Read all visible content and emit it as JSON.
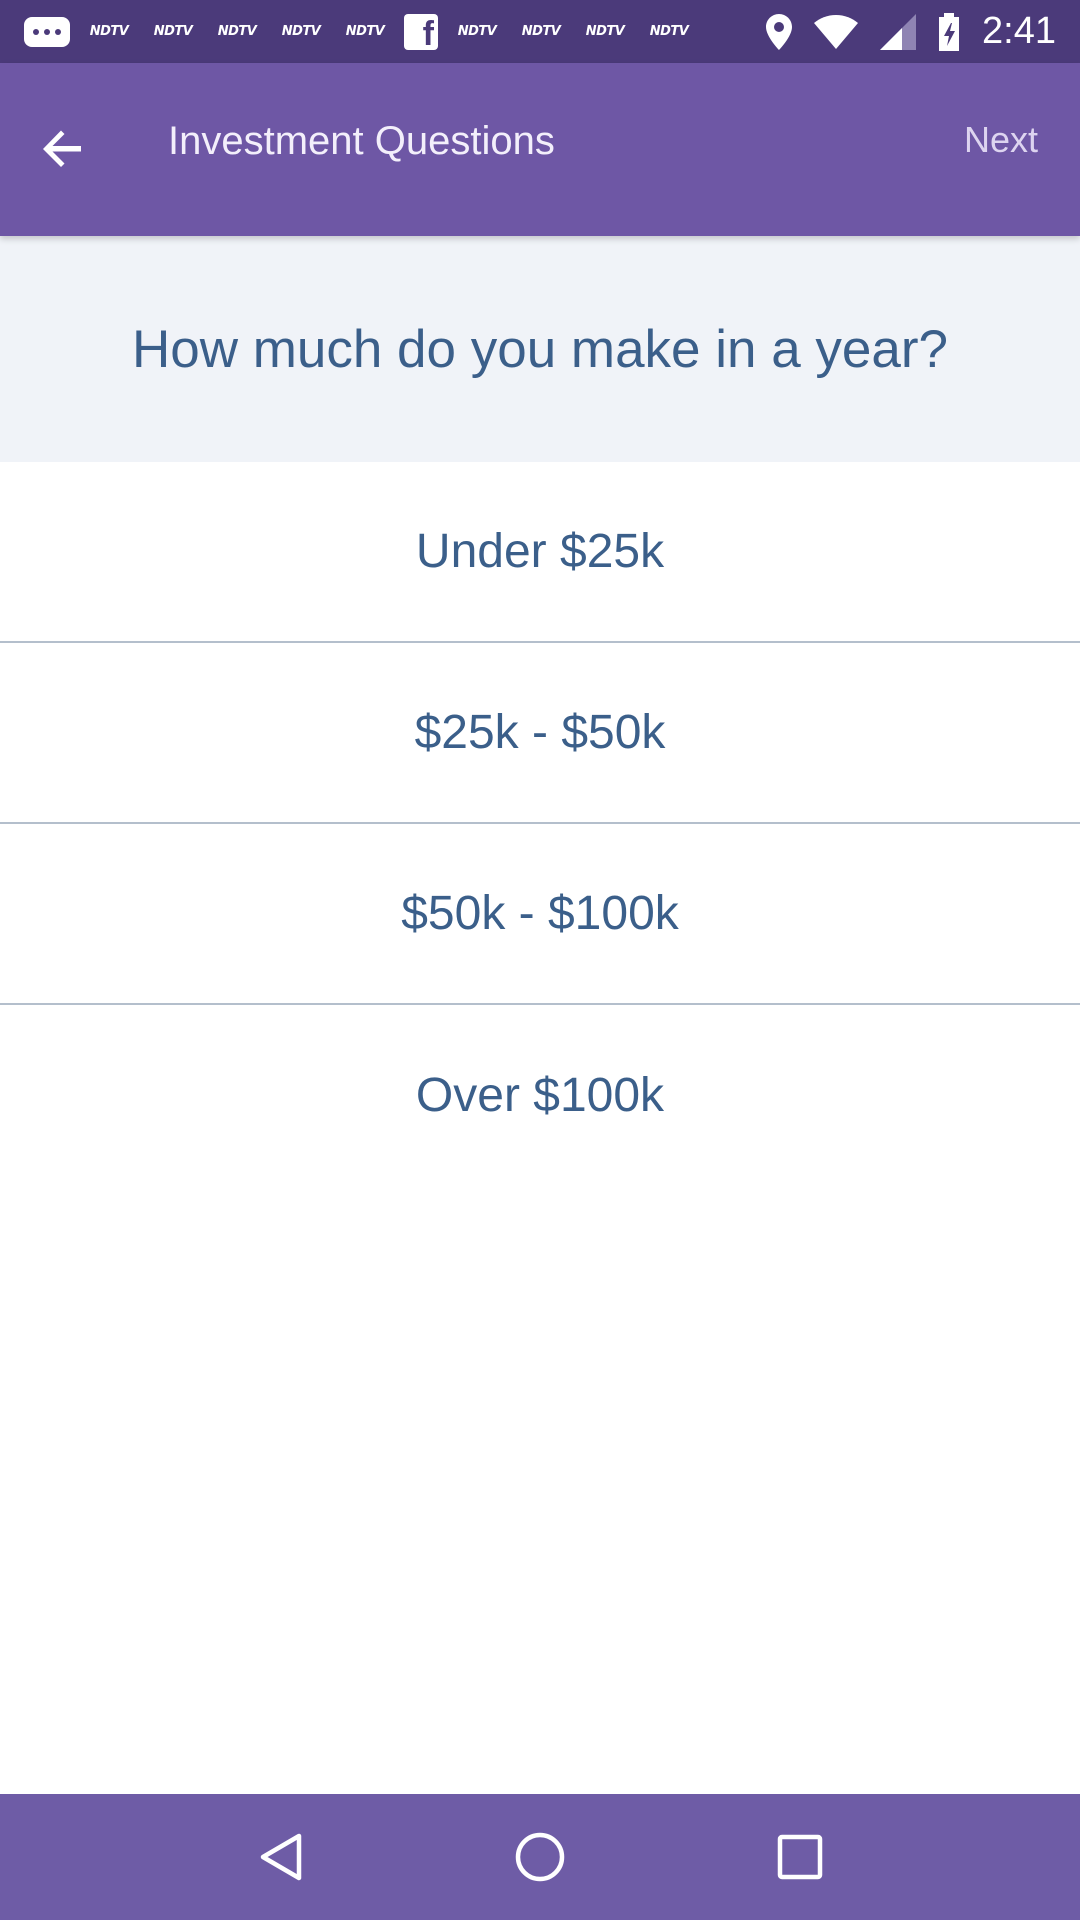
{
  "status_bar": {
    "notification_icons": [
      "message-icon",
      "ndtv",
      "ndtv",
      "ndtv",
      "ndtv",
      "ndtv",
      "facebook-icon",
      "ndtv",
      "ndtv",
      "ndtv",
      "ndtv"
    ],
    "ndtv_label": "NDTV",
    "time": "2:41"
  },
  "app_bar": {
    "title": "Investment Questions",
    "next_label": "Next",
    "background": "#6e57a5"
  },
  "question": {
    "text": "How much do you make in a year?"
  },
  "options": [
    {
      "label": "Under $25k"
    },
    {
      "label": "$25k - $50k"
    },
    {
      "label": "$50k - $100k"
    },
    {
      "label": "Over $100k"
    }
  ],
  "nav_bar": {
    "buttons": [
      "back-triangle-icon",
      "home-circle-icon",
      "recents-square-icon"
    ],
    "background": "#6e5ca6"
  },
  "colors": {
    "accent_text": "#3b5f8a",
    "question_bg": "#f0f3f8"
  }
}
